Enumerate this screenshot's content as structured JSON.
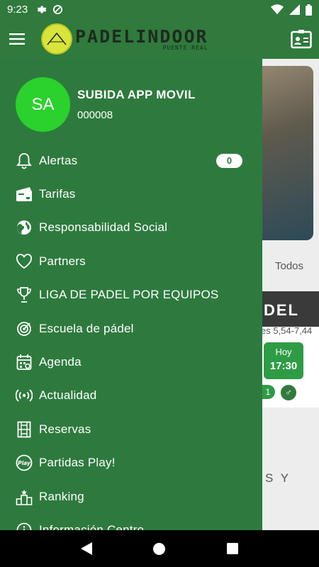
{
  "status_bar": {
    "time": "9:23"
  },
  "app_bar": {
    "logo_main": "PADELINDOOR",
    "logo_sub": "PUENTE REAL"
  },
  "background": {
    "todos_label": "Todos",
    "del_text": "DEL",
    "sub_text": "es 5,54-7,44",
    "hoy_label": "Hoy",
    "hoy_time": "17:30",
    "pill_text": "1",
    "bottom_text": "S Y"
  },
  "profile": {
    "initials": "SA",
    "name": "SUBIDA APP MOVIL",
    "code": "000008"
  },
  "menu": {
    "items": [
      {
        "label": "Alertas",
        "icon": "bell-icon",
        "badge": "0"
      },
      {
        "label": "Tarifas",
        "icon": "card-icon"
      },
      {
        "label": "Responsabilidad Social",
        "icon": "globe-icon"
      },
      {
        "label": "Partners",
        "icon": "heart-icon"
      },
      {
        "label": "LIGA DE PADEL POR EQUIPOS",
        "icon": "trophy-icon"
      },
      {
        "label": "Escuela de pádel",
        "icon": "target-icon"
      },
      {
        "label": "Agenda",
        "icon": "calendar-icon"
      },
      {
        "label": "Actualidad",
        "icon": "broadcast-icon"
      },
      {
        "label": "Reservas",
        "icon": "court-icon"
      },
      {
        "label": "Partidas Play!",
        "icon": "play-badge-icon"
      },
      {
        "label": "Ranking",
        "icon": "podium-icon"
      },
      {
        "label": "Información Centro",
        "icon": "info-icon"
      }
    ]
  },
  "colors": {
    "primary": "#2f7a3c",
    "drawer": "#2e7a3e",
    "avatar": "#2bd12d",
    "logo": "#d8e43a"
  }
}
